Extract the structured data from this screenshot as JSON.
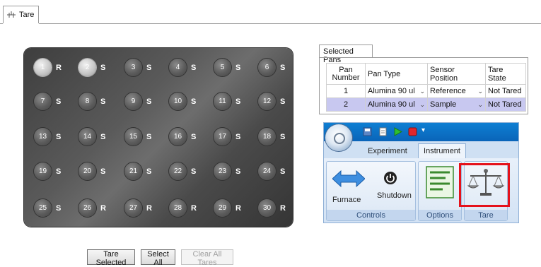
{
  "top_tab": {
    "label": "Tare"
  },
  "tray": {
    "pans": [
      {
        "number": "1",
        "type": "R",
        "selected": true
      },
      {
        "number": "2",
        "type": "S",
        "selected": true
      },
      {
        "number": "3",
        "type": "S",
        "selected": false
      },
      {
        "number": "4",
        "type": "S",
        "selected": false
      },
      {
        "number": "5",
        "type": "S",
        "selected": false
      },
      {
        "number": "6",
        "type": "S",
        "selected": false
      },
      {
        "number": "7",
        "type": "S",
        "selected": false
      },
      {
        "number": "8",
        "type": "S",
        "selected": false
      },
      {
        "number": "9",
        "type": "S",
        "selected": false
      },
      {
        "number": "10",
        "type": "S",
        "selected": false
      },
      {
        "number": "11",
        "type": "S",
        "selected": false
      },
      {
        "number": "12",
        "type": "S",
        "selected": false
      },
      {
        "number": "13",
        "type": "S",
        "selected": false
      },
      {
        "number": "14",
        "type": "S",
        "selected": false
      },
      {
        "number": "15",
        "type": "S",
        "selected": false
      },
      {
        "number": "16",
        "type": "S",
        "selected": false
      },
      {
        "number": "17",
        "type": "S",
        "selected": false
      },
      {
        "number": "18",
        "type": "S",
        "selected": false
      },
      {
        "number": "19",
        "type": "S",
        "selected": false
      },
      {
        "number": "20",
        "type": "S",
        "selected": false
      },
      {
        "number": "21",
        "type": "S",
        "selected": false
      },
      {
        "number": "22",
        "type": "S",
        "selected": false
      },
      {
        "number": "23",
        "type": "S",
        "selected": false
      },
      {
        "number": "24",
        "type": "S",
        "selected": false
      },
      {
        "number": "25",
        "type": "S",
        "selected": false
      },
      {
        "number": "26",
        "type": "R",
        "selected": false
      },
      {
        "number": "27",
        "type": "R",
        "selected": false
      },
      {
        "number": "28",
        "type": "R",
        "selected": false
      },
      {
        "number": "29",
        "type": "R",
        "selected": false
      },
      {
        "number": "30",
        "type": "R",
        "selected": false
      }
    ]
  },
  "buttons": {
    "tare_selected": "Tare Selected",
    "select_all": "Select All",
    "clear_all_tares": "Clear All Tares"
  },
  "selected_pans": {
    "tab_label": "Selected Pans",
    "columns": [
      "Pan Number",
      "Pan Type",
      "Sensor Position",
      "Tare State"
    ],
    "rows": [
      {
        "pan_number": "1",
        "pan_type": "Alumina 90 ul",
        "sensor_position": "Reference",
        "tare_state": "Not Tared"
      },
      {
        "pan_number": "2",
        "pan_type": "Alumina 90 ul",
        "sensor_position": "Sample",
        "tare_state": "Not Tared"
      }
    ]
  },
  "ribbon": {
    "tabs": [
      "Experiment",
      "Instrument"
    ],
    "active_tab": "Instrument",
    "buttons": {
      "furnace": "Furnace",
      "shutdown": "Shutdown"
    },
    "groups": {
      "controls": "Controls",
      "options": "Options",
      "tare": "Tare"
    },
    "icons": [
      "app-orb-icon",
      "save-icon",
      "document-icon",
      "play-icon",
      "stop-icon",
      "dropdown-icon",
      "furnace-arrows-icon",
      "power-icon",
      "options-list-icon",
      "balance-scale-icon"
    ],
    "colors": {
      "title_bar": "#0a64b9",
      "highlight": "#e5121b",
      "selected_row": "#c8c8f0"
    }
  }
}
